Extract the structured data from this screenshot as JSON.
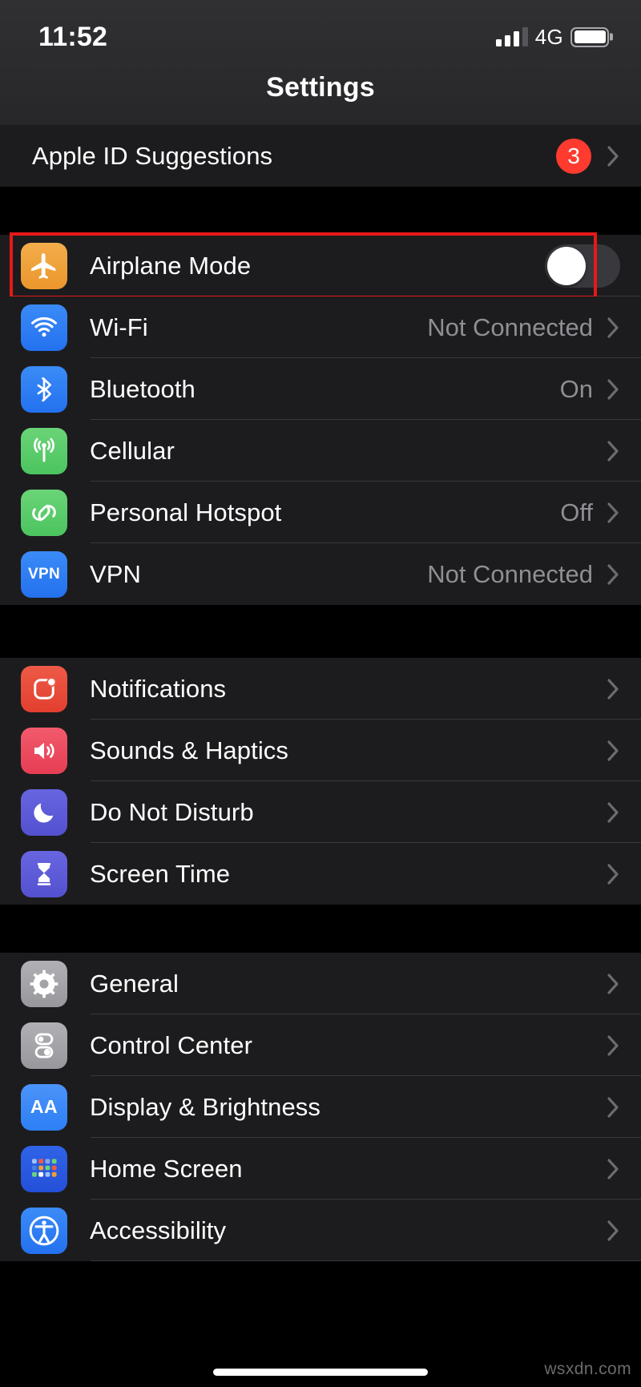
{
  "status_bar": {
    "time": "11:52",
    "network": "4G",
    "signal_bars_active": 3,
    "signal_bars_total": 4,
    "battery_level_percent": 95,
    "battery_icon": "battery-icon"
  },
  "nav": {
    "title": "Settings"
  },
  "colors": {
    "row_background": "#1C1C1E",
    "page_background": "#000000",
    "separator": "#38383A",
    "value_text": "#8E8E93",
    "badge_red": "#FF3B30",
    "highlight_red": "#E61919",
    "toggle_off_track": "#39393D",
    "toggle_knob": "#FFFFFF",
    "icon_orange": "#F0A030",
    "icon_blue": "#2D7FF5",
    "icon_green": "#5CCE6B",
    "icon_red": "#EB4D3D",
    "icon_pink": "#EE4C5F",
    "icon_purple": "#5856D6",
    "icon_gray": "#A3A3A8"
  },
  "groups": [
    {
      "name": "apple-id-group",
      "rows": [
        {
          "name": "apple-id-suggestions",
          "label": "Apple ID Suggestions",
          "badge": "3",
          "accessory": "chevron-right-icon",
          "icon": null
        }
      ]
    },
    {
      "name": "connectivity-group",
      "rows": [
        {
          "name": "airplane-mode",
          "label": "Airplane Mode",
          "icon": "airplane-icon",
          "accessory": "toggle-switch",
          "toggle_on": false,
          "highlighted": true
        },
        {
          "name": "wifi",
          "label": "Wi-Fi",
          "value": "Not Connected",
          "icon": "wifi-icon",
          "accessory": "chevron-right-icon"
        },
        {
          "name": "bluetooth",
          "label": "Bluetooth",
          "value": "On",
          "icon": "bluetooth-icon",
          "accessory": "chevron-right-icon"
        },
        {
          "name": "cellular",
          "label": "Cellular",
          "value": "",
          "icon": "cellular-antenna-icon",
          "accessory": "chevron-right-icon"
        },
        {
          "name": "personal-hotspot",
          "label": "Personal Hotspot",
          "value": "Off",
          "icon": "hotspot-link-icon",
          "accessory": "chevron-right-icon"
        },
        {
          "name": "vpn",
          "label": "VPN",
          "value": "Not Connected",
          "icon": "vpn-icon",
          "icon_text": "VPN",
          "accessory": "chevron-right-icon"
        }
      ]
    },
    {
      "name": "notifications-group",
      "rows": [
        {
          "name": "notifications",
          "label": "Notifications",
          "value": "",
          "icon": "notifications-bell-icon",
          "accessory": "chevron-right-icon"
        },
        {
          "name": "sounds-haptics",
          "label": "Sounds & Haptics",
          "value": "",
          "icon": "speaker-icon",
          "accessory": "chevron-right-icon"
        },
        {
          "name": "do-not-disturb",
          "label": "Do Not Disturb",
          "value": "",
          "icon": "moon-icon",
          "accessory": "chevron-right-icon"
        },
        {
          "name": "screen-time",
          "label": "Screen Time",
          "value": "",
          "icon": "hourglass-icon",
          "accessory": "chevron-right-icon"
        }
      ]
    },
    {
      "name": "system-group",
      "rows": [
        {
          "name": "general",
          "label": "General",
          "value": "",
          "icon": "gear-icon",
          "accessory": "chevron-right-icon"
        },
        {
          "name": "control-center",
          "label": "Control Center",
          "value": "",
          "icon": "toggles-icon",
          "accessory": "chevron-right-icon"
        },
        {
          "name": "display-brightness",
          "label": "Display & Brightness",
          "value": "",
          "icon": "display-aa-icon",
          "icon_text": "AA",
          "accessory": "chevron-right-icon"
        },
        {
          "name": "home-screen",
          "label": "Home Screen",
          "value": "",
          "icon": "app-grid-icon",
          "accessory": "chevron-right-icon"
        },
        {
          "name": "accessibility",
          "label": "Accessibility",
          "value": "",
          "icon": "accessibility-person-icon",
          "accessory": "chevron-right-icon"
        }
      ]
    }
  ],
  "watermark": "wsxdn.com"
}
